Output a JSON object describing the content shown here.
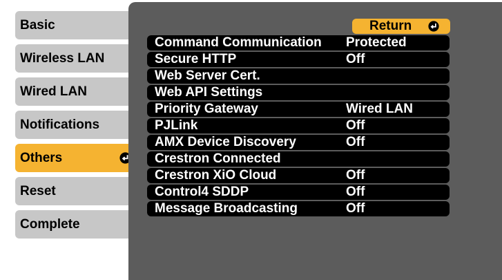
{
  "sidebar": {
    "tabs": [
      {
        "label": "Basic",
        "selected": false
      },
      {
        "label": "Wireless LAN",
        "selected": false
      },
      {
        "label": "Wired LAN",
        "selected": false
      },
      {
        "label": "Notifications",
        "selected": false
      },
      {
        "label": "Others",
        "selected": true
      },
      {
        "label": "Reset",
        "selected": false
      },
      {
        "label": "Complete",
        "selected": false
      }
    ]
  },
  "return_button": {
    "label": "Return",
    "icon": "enter-icon"
  },
  "settings": [
    {
      "label": "Command Communication",
      "value": "Protected"
    },
    {
      "label": "Secure HTTP",
      "value": "Off"
    },
    {
      "label": "Web Server Cert.",
      "value": ""
    },
    {
      "label": "Web API Settings",
      "value": ""
    },
    {
      "label": "Priority Gateway",
      "value": "Wired LAN"
    },
    {
      "label": "PJLink",
      "value": "Off"
    },
    {
      "label": "AMX Device Discovery",
      "value": "Off"
    },
    {
      "label": "Crestron Connected",
      "value": ""
    },
    {
      "label": "Crestron XiO Cloud",
      "value": "Off"
    },
    {
      "label": "Control4 SDDP",
      "value": "Off"
    },
    {
      "label": "Message Broadcasting",
      "value": "Off"
    }
  ],
  "colors": {
    "accent": "#f5b331",
    "tab_bg": "#c7c7c7",
    "panel_bg": "#5c5c5c",
    "row_bg": "#000000",
    "text_light": "#ffffff"
  }
}
